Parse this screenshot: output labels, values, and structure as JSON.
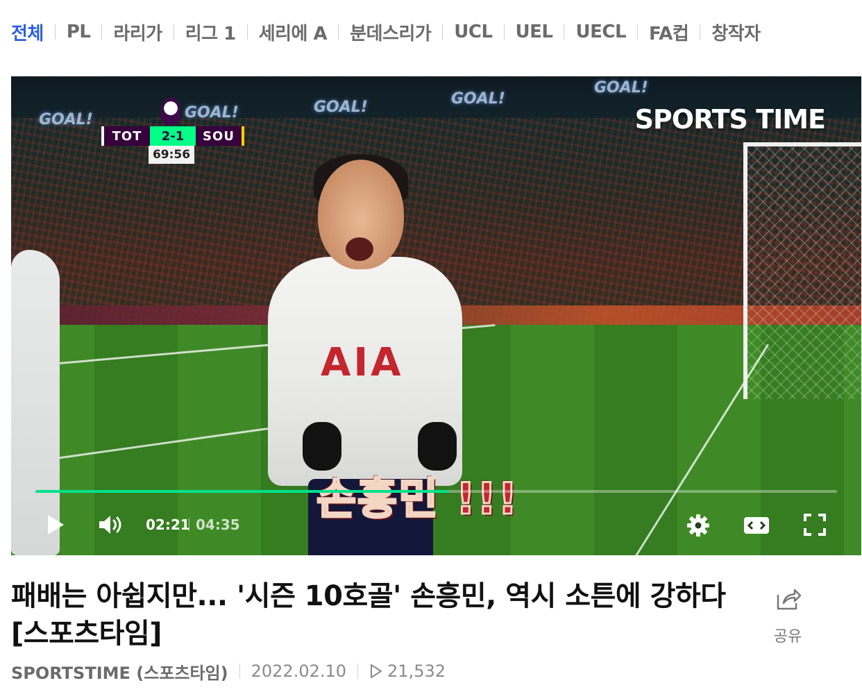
{
  "nav": {
    "items": [
      {
        "label": "전체",
        "active": true
      },
      {
        "label": "PL",
        "active": false
      },
      {
        "label": "라리가",
        "active": false
      },
      {
        "label": "리그 1",
        "active": false
      },
      {
        "label": "세리에 A",
        "active": false
      },
      {
        "label": "분데스리가",
        "active": false
      },
      {
        "label": "UCL",
        "active": false
      },
      {
        "label": "UEL",
        "active": false
      },
      {
        "label": "UECL",
        "active": false
      },
      {
        "label": "FA컵",
        "active": false
      },
      {
        "label": "창작자",
        "active": false
      }
    ]
  },
  "video": {
    "broadcaster": "SPORTS TIME",
    "goal_signs": [
      "GOAL!",
      "GOAL!",
      "GOAL!",
      "GOAL!",
      "GOAL!"
    ],
    "scoreboard": {
      "home": "TOT",
      "score": "2-1",
      "away": "SOU",
      "clock": "69:56"
    },
    "sponsor": "AIA",
    "caption": "손흥민 !!!",
    "progress_fraction": 0.515,
    "current_time": "02:21",
    "total_time": "04:35",
    "accent_color": "#00e38c"
  },
  "icons": {
    "play": "play-icon",
    "volume": "volume-icon",
    "settings": "gear-icon",
    "theater": "theater-mode-icon",
    "fullscreen": "fullscreen-icon",
    "share": "share-icon",
    "views": "play-count-icon"
  },
  "title": "패배는 아쉽지만... '시즌 10호골' 손흥민, 역시 소튼에 강하다 [스포츠타임]",
  "share_label": "공유",
  "meta": {
    "channel": "SPORTSTIME (스포츠타임)",
    "date": "2022.02.10",
    "views": "21,532"
  }
}
